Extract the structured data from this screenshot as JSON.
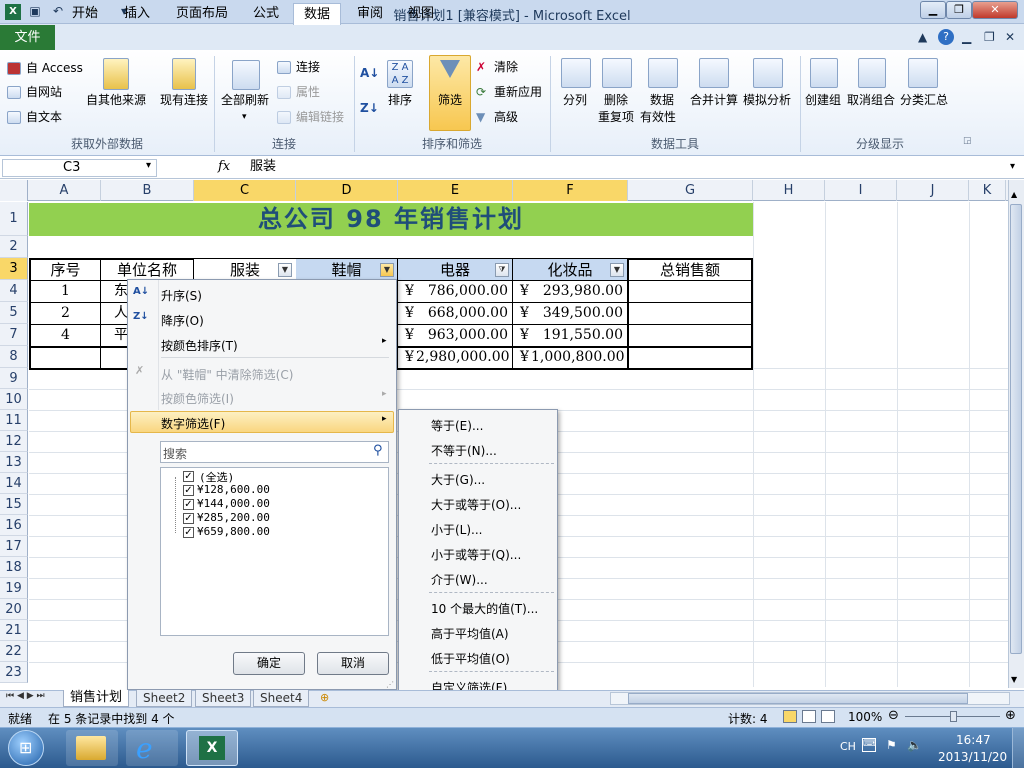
{
  "window": {
    "title": "销售计划1 [兼容模式] - Microsoft Excel"
  },
  "ribbon_tabs": [
    "开始",
    "插入",
    "页面布局",
    "公式",
    "数据",
    "审阅",
    "视图"
  ],
  "file_tab": "文件",
  "ribbon": {
    "get_external": {
      "access": "自 Access",
      "web": "自网站",
      "text": "自文本",
      "other": "自其他来源",
      "existing": "现有连接",
      "label": "获取外部数据"
    },
    "connections": {
      "refresh_all": "全部刷新",
      "connections": "连接",
      "properties": "属性",
      "edit_links": "编辑链接",
      "label": "连接"
    },
    "sort_filter": {
      "sort": "排序",
      "filter": "筛选",
      "clear": "清除",
      "reapply": "重新应用",
      "advanced": "高级",
      "label": "排序和筛选"
    },
    "data_tools": {
      "text_to_columns": "分列",
      "remove_dup_1": "删除",
      "remove_dup_2": "重复项",
      "validation_1": "数据",
      "validation_2": "有效性",
      "consolidate": "合并计算",
      "whatif": "模拟分析",
      "label": "数据工具"
    },
    "outline": {
      "group": "创建组",
      "ungroup": "取消组合",
      "subtotal": "分类汇总",
      "label": "分级显示"
    }
  },
  "formula_bar": {
    "name_box": "C3",
    "fx": "fx",
    "value": "服装"
  },
  "columns": [
    "A",
    "B",
    "C",
    "D",
    "E",
    "F",
    "G",
    "H",
    "I",
    "J",
    "K"
  ],
  "rows": [
    "1",
    "2",
    "3",
    "4",
    "5",
    "7",
    "8",
    "9",
    "10",
    "11",
    "12",
    "13",
    "14",
    "15",
    "16",
    "17",
    "18",
    "19",
    "20",
    "21",
    "22",
    "23"
  ],
  "sheet": {
    "banner": "总公司 98 年销售计划",
    "headers": {
      "seq": "序号",
      "unit": "单位名称",
      "clothing": "服装",
      "hats": "鞋帽",
      "electric": "电器",
      "cosmetics": "化妆品",
      "total": "总销售额"
    },
    "data_rows": [
      {
        "seq": "1",
        "unit": "东",
        "electric": "786,000.00",
        "cosmetics": "293,980.00"
      },
      {
        "seq": "2",
        "unit": "人",
        "electric": "668,000.00",
        "cosmetics": "349,500.00"
      },
      {
        "seq": "4",
        "unit": "平",
        "electric": "963,000.00",
        "cosmetics": "191,550.00"
      }
    ],
    "total_row": {
      "electric": "2,980,000.00",
      "cosmetics": "1,000,800.00"
    },
    "currency": "¥"
  },
  "filter_menu": {
    "sort_asc": "升序(S)",
    "sort_desc": "降序(O)",
    "sort_color": "按颜色排序(T)",
    "clear_filter": "从 \"鞋帽\" 中清除筛选(C)",
    "filter_color": "按颜色筛选(I)",
    "number_filter": "数字筛选(F)",
    "search_placeholder": "搜索",
    "items": [
      "(全选)",
      "¥128,600.00",
      "¥144,000.00",
      "¥285,200.00",
      "¥659,800.00"
    ],
    "ok": "确定",
    "cancel": "取消"
  },
  "number_submenu": [
    "等于(E)...",
    "不等于(N)...",
    "大于(G)...",
    "大于或等于(O)...",
    "小于(L)...",
    "小于或等于(Q)...",
    "介于(W)...",
    "10 个最大的值(T)...",
    "高于平均值(A)",
    "低于平均值(O)",
    "自定义筛选(F)..."
  ],
  "sheet_tabs": [
    "销售计划",
    "Sheet2",
    "Sheet3",
    "Sheet4"
  ],
  "status": {
    "ready": "就绪",
    "found": "在 5 条记录中找到 4 个",
    "count": "计数: 4",
    "zoom": "100%"
  },
  "taskbar": {
    "lang": "CH",
    "time": "16:47",
    "date": "2013/11/20"
  }
}
